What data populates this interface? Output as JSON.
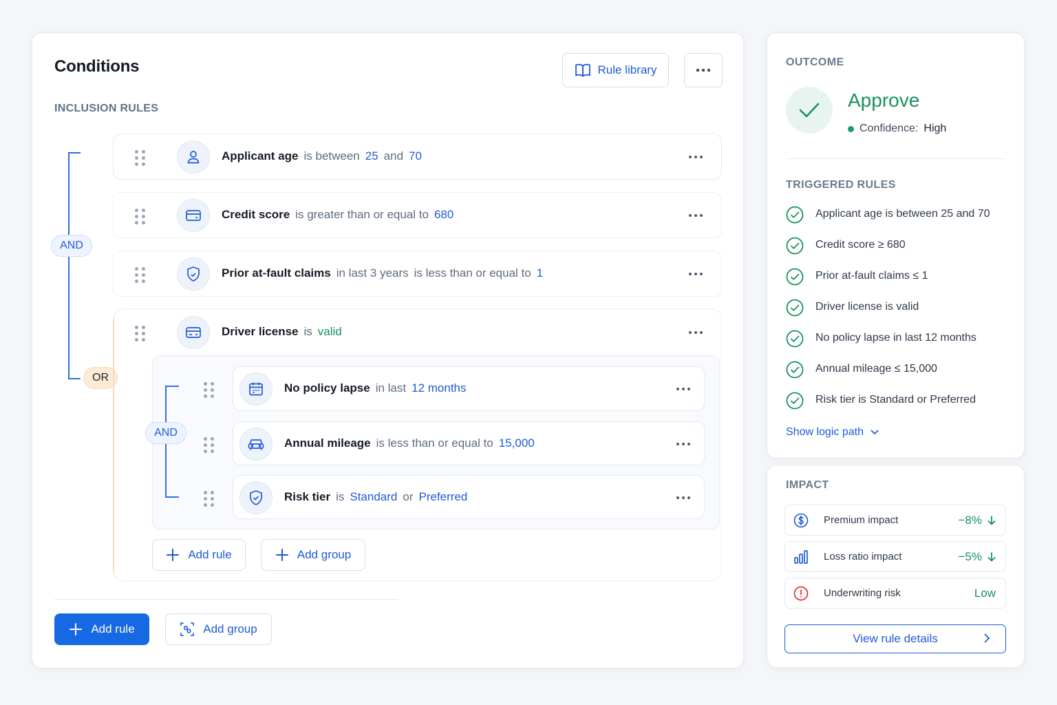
{
  "conditions": {
    "title": "Conditions",
    "rule_library_label": "Rule library",
    "inclusion_label": "INCLUSION RULES",
    "connector_and": "AND",
    "connector_or": "OR",
    "nested_connector_and": "AND",
    "rules": [
      {
        "field": "Applicant age",
        "parts": [
          {
            "t": "op",
            "v": "is between"
          },
          {
            "t": "val",
            "v": "25"
          },
          {
            "t": "op",
            "v": "and"
          },
          {
            "t": "val",
            "v": "70"
          }
        ],
        "icon": "user-icon"
      },
      {
        "field": "Credit score",
        "parts": [
          {
            "t": "op",
            "v": "is greater than or equal to"
          },
          {
            "t": "val",
            "v": "680"
          }
        ],
        "icon": "credit-card-icon"
      },
      {
        "field": "Prior at-fault claims",
        "parts": [
          {
            "t": "op",
            "v": "in last 3 years"
          },
          {
            "t": "op",
            "v": "is less than or equal to"
          },
          {
            "t": "val",
            "v": "1"
          }
        ],
        "icon": "shield-icon"
      },
      {
        "field": "Driver license",
        "parts": [
          {
            "t": "op",
            "v": "is"
          },
          {
            "t": "val-green",
            "v": "valid"
          }
        ],
        "icon": "license-card-icon"
      }
    ],
    "nested_rules": [
      {
        "field": "No policy lapse",
        "parts": [
          {
            "t": "op",
            "v": "in last"
          },
          {
            "t": "val",
            "v": "12 months"
          }
        ],
        "icon": "calendar-icon"
      },
      {
        "field": "Annual mileage",
        "parts": [
          {
            "t": "op",
            "v": "is less than or equal to"
          },
          {
            "t": "val",
            "v": "15,000"
          }
        ],
        "icon": "car-icon"
      },
      {
        "field": "Risk tier",
        "parts": [
          {
            "t": "op",
            "v": "is"
          },
          {
            "t": "val",
            "v": "Standard"
          },
          {
            "t": "op",
            "v": "or"
          },
          {
            "t": "val",
            "v": "Preferred"
          }
        ],
        "icon": "shield-check-icon"
      }
    ],
    "group_add_rule": "Add rule",
    "group_add_group": "Add group",
    "footer_add_rule": "Add rule",
    "footer_add_group": "Add group"
  },
  "outcome": {
    "label": "OUTCOME",
    "decision": "Approve",
    "confidence_label": "Confidence:",
    "confidence_value": "High",
    "triggered_label": "TRIGGERED RULES",
    "triggered": [
      "Applicant age is between 25 and 70",
      "Credit score ≥ 680",
      "Prior at-fault claims ≤ 1",
      "Driver license is valid",
      "No policy lapse in last 12 months",
      "Annual mileage ≤ 15,000",
      "Risk tier is Standard or Preferred"
    ],
    "show_logic": "Show logic path"
  },
  "impact": {
    "label": "IMPACT",
    "rows": [
      {
        "label": "Premium impact",
        "value": "−8%",
        "icon": "dollar-icon"
      },
      {
        "label": "Loss ratio impact",
        "value": "−5%",
        "icon": "bar-chart-icon"
      },
      {
        "label": "Underwriting risk",
        "value": "Low",
        "icon": "alert-icon"
      }
    ],
    "details_button": "View rule details"
  },
  "colors": {
    "accent": "#1e5ad6",
    "primary": "#1668e3",
    "success": "#17915c",
    "danger": "#e0303a",
    "or_tag": "#fdebd6"
  }
}
